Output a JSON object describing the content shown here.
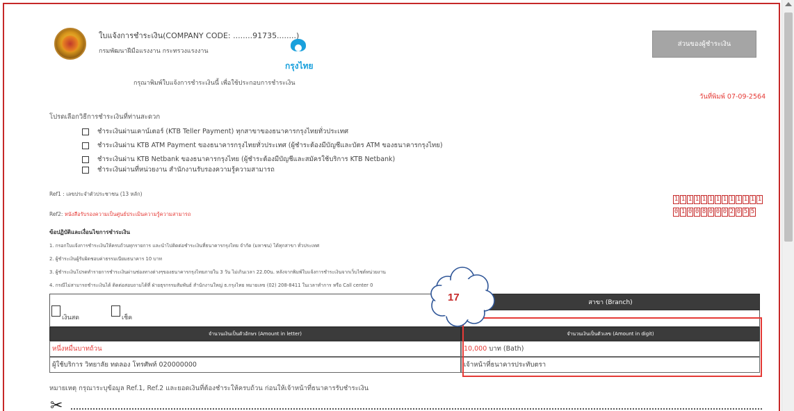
{
  "header": {
    "notice_title": "ใบแจ้งการชำระเงิน(COMPANY CODE: ........91735........)",
    "dept_name": "กรมพัฒนาฝีมือแรงงาน กระทรวงแรงงาน",
    "bank_name": "กรุงไทย",
    "print_instruction": "กรุณาพิมพ์ใบแจ้งการชำระเงินนี้ เพื่อใช้ประกอบการชำระเงิน",
    "payer_part": "ส่วนของผู้ชำระเงิน",
    "print_date": "วันที่พิมพ์ 07-09-2564"
  },
  "methods": {
    "title": "โปรดเลือกวิธีการชำระเงินที่ท่านสะดวก",
    "items": [
      "ชำระเงินผ่านเคาน์เตอร์ (KTB Teller Payment) ทุกสาขาของธนาคารกรุงไทยทั่วประเทศ",
      "ชำระเงินผ่าน KTB ATM Payment ของธนาคารกรุงไทยทั่วประเทศ (ผู้ชำระต้องมีบัญชีและบัตร ATM ของธนาคารกรุงไทย)",
      "ชำระเงินผ่าน KTB Netbank ของธนาคารกรุงไทย (ผู้ชำระต้องมีบัญชีและสมัครใช้บริการ KTB Netbank)",
      "ชำระเงินผ่านที่หน่วยงาน สำนักงานรับรองความรู้ความสามารถ"
    ]
  },
  "refs": {
    "ref1": "Ref1 : เลขประจำตัวประชาชน (13 หลัก)",
    "ref2_label": "Ref2: ",
    "ref2_value": "หนังสือรับรองความเป็นศูนย์ประเมินความรู้ความสามารถ",
    "ref1_digits": [
      "1",
      "1",
      "1",
      "1",
      "1",
      "1",
      "1",
      "1",
      "1",
      "1",
      "1",
      "1",
      "1"
    ],
    "ref2_digits": [
      "0",
      "1",
      "0",
      "0",
      "8",
      "0",
      "0",
      "0",
      "2",
      "0",
      "5",
      "5"
    ]
  },
  "rules": {
    "title": "ข้อปฏิบัติและเงื่อนไขการชำระเงิน",
    "items": [
      "1. กรอกใบแจ้งการชำระเงินให้ครบถ้วนทุกรายการ และนำไปติดต่อชำระเงินที่ธนาคารกรุงไทย จำกัด (มหาชน) ได้ทุกสาขา ทั่วประเทศ",
      "2. ผู้ชำระเงินผู้รับผิดชอบค่าธรรมเนียมธนาคาร 10 บาท",
      "3. ผู้ชำระเงินโปรดทำรายการชำระเงินผ่านช่องทางต่างๆของธนาคารกรุงไทยภายใน 3 วัน ไม่เกินเวลา 22.00น. หลังจากพิมพ์ใบแจ้งการชำระเงินจากเว็บไซต์หน่วยงาน",
      "4. กรณีไม่สามารถชำระเงินได้ ติดต่อสอบถามได้ที่ ฝ่ายธุรกรรมสัมพันธ์ สำนักงานใหญ่ ธ.กรุงไทย หมายเลข (02) 208-8411 ในเวลาทำการ หรือ Call center 0"
    ]
  },
  "payment_table": {
    "cash": "เงินสด",
    "cheque": "เช็ค",
    "branch_header": "สาขา (Branch)",
    "amount_letter_header": "จำนวนเงินเป็นตัวอักษร (Amount in letter)",
    "amount_digit_header": "จำนวนเงินเป็นตัวเลข (Amount in digit)",
    "amount_letter_value": "หนึ่งหมื่นบาทถ้วน",
    "amount_digit_value": "10,000",
    "amount_digit_unit": "บาท (Bath)",
    "service_user": "ผู้ใช้บริการ วิทยาลัย ทดลอง โทรศัพท์ 020000000",
    "bank_officer": "เจ้าหน้าที่ธนาคารประทับตรา"
  },
  "remark": "หมายเหตุ กรุณาระบุข้อมูล Ref.1, Ref.2 และยอดเงินที่ต้องชำระให้ครบถ้วน ก่อนให้เจ้าหน้าที่ธนาคารรับชำระเงิน",
  "annotation": {
    "callout_number": "17",
    "color": "#e53935"
  }
}
